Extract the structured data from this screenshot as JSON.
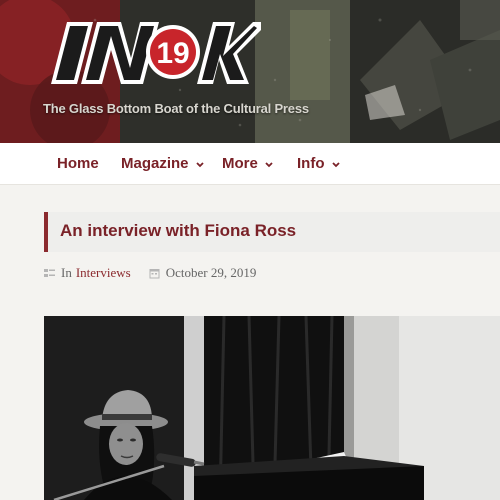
{
  "site": {
    "logo_text": "IN19K",
    "tagline": "The Glass Bottom Boat of the Cultural Press"
  },
  "nav": {
    "items": [
      {
        "label": "Home",
        "has_dropdown": false
      },
      {
        "label": "Magazine",
        "has_dropdown": true
      },
      {
        "label": "More",
        "has_dropdown": true
      },
      {
        "label": "Info",
        "has_dropdown": true
      }
    ]
  },
  "article": {
    "title": "An interview with Fiona Ross",
    "category_prefix": "In",
    "category": "Interviews",
    "date": "October 29, 2019",
    "category_icon": "folder-icon",
    "date_icon": "calendar-icon"
  },
  "colors": {
    "accent": "#7a2228",
    "logo_red": "#c8252b",
    "nav_bg": "#ffffff",
    "title_bg": "#eeeeec"
  }
}
